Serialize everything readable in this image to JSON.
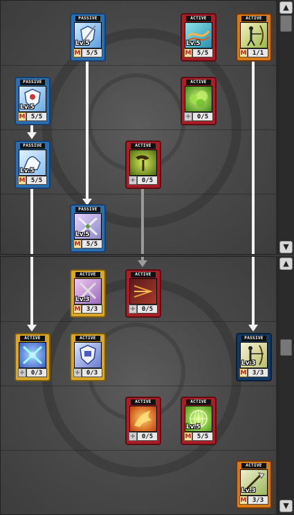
{
  "scroll": {
    "up": "▲",
    "down": "▼"
  },
  "skills": [
    {
      "id": "s1",
      "tag": "PASSIVE",
      "lv": "Lv.5",
      "badge": "M",
      "points": "5/5",
      "icon": "shield-spear-icon"
    },
    {
      "id": "s2",
      "tag": "ACTIVE",
      "lv": "Lv.5",
      "badge": "M",
      "points": "5/5",
      "icon": "energy-wave-icon"
    },
    {
      "id": "s3",
      "tag": "ACTIVE",
      "lv": "",
      "badge": "M",
      "points": "1/1",
      "icon": "archer-bow-icon"
    },
    {
      "id": "s4",
      "tag": "PASSIVE",
      "lv": "Lv.5",
      "badge": "M",
      "points": "5/5",
      "icon": "shield-armor-icon"
    },
    {
      "id": "s5",
      "tag": "ACTIVE",
      "lv": "",
      "badge": "+",
      "points": "0/5",
      "icon": "green-cloud-icon"
    },
    {
      "id": "s6",
      "tag": "PASSIVE",
      "lv": "Lv.5",
      "badge": "M",
      "points": "5/5",
      "icon": "strong-arm-icon"
    },
    {
      "id": "s7",
      "tag": "ACTIVE",
      "lv": "",
      "badge": "+",
      "points": "0/5",
      "icon": "boomerang-icon"
    },
    {
      "id": "s8",
      "tag": "PASSIVE",
      "lv": "Lv.5",
      "badge": "M",
      "points": "5/5",
      "icon": "crossed-swords-icon"
    },
    {
      "id": "s9",
      "tag": "ACTIVE",
      "lv": "Lv.3",
      "badge": "M",
      "points": "3/3",
      "icon": "crossed-blades-icon"
    },
    {
      "id": "s10",
      "tag": "ACTIVE",
      "lv": "",
      "badge": "+",
      "points": "0/5",
      "icon": "arrow-burst-icon"
    },
    {
      "id": "s11",
      "tag": "ACTIVE",
      "lv": "",
      "badge": "+",
      "points": "0/3",
      "icon": "crossed-bolts-icon"
    },
    {
      "id": "s12",
      "tag": "ACTIVE",
      "lv": "",
      "badge": "+",
      "points": "0/3",
      "icon": "shield-helmet-icon"
    },
    {
      "id": "s13",
      "tag": "PASSIVE",
      "lv": "Lv.3",
      "badge": "M",
      "points": "3/3",
      "icon": "archer-aim-icon"
    },
    {
      "id": "s14",
      "tag": "ACTIVE",
      "lv": "",
      "badge": "+",
      "points": "0/5",
      "icon": "phoenix-icon"
    },
    {
      "id": "s15",
      "tag": "ACTIVE",
      "lv": "Lv.5",
      "badge": "M",
      "points": "5/5",
      "icon": "green-net-icon"
    },
    {
      "id": "s16",
      "tag": "ACTIVE",
      "lv": "Lv.3",
      "badge": "M",
      "points": "3/3",
      "icon": "spear-strike-icon"
    }
  ]
}
